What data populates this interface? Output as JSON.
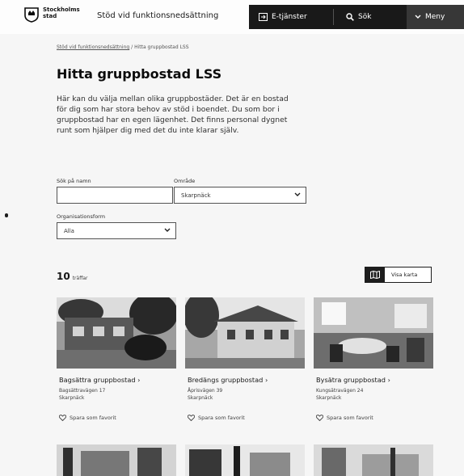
{
  "header": {
    "logo_text": "Stockholms stad",
    "site_title": "Stöd vid funktionsnedsättning",
    "nav": {
      "eservices": "E-tjänster",
      "search": "Sök",
      "menu": "Meny"
    }
  },
  "breadcrumb": {
    "parent": "Stöd vid funktionsnedsättning",
    "separator": "/",
    "current": "Hitta gruppbostad LSS"
  },
  "page": {
    "title": "Hitta gruppbostad LSS",
    "intro": "Här kan du välja mellan olika gruppbostäder. Det är en bostad för dig som har stora behov av stöd i boendet. Du som bor i gruppbostad har en egen lägenhet. Det finns personal dygnet runt som hjälper dig med det du inte klarar själv."
  },
  "filters": {
    "name_label": "Sök på namn",
    "name_value": "",
    "area_label": "Område",
    "area_value": "Skarpnäck",
    "org_label": "Organisationsform",
    "org_value": "Alla"
  },
  "results": {
    "count": "10",
    "unit": "träffar",
    "map_button": "Visa karta"
  },
  "cards": [
    {
      "name": "Bagsättra gruppbostad ›",
      "address": "Bagsättravägen 17",
      "area": "Skarpnäck",
      "fav": "Spara som favorit"
    },
    {
      "name": "Bredängs gruppbostad ›",
      "address": "Åprisvägen 39",
      "area": "Skarpnäck",
      "fav": "Spara som favorit"
    },
    {
      "name": "Bysätra gruppbostad ›",
      "address": "Kungsätravägen 24",
      "area": "Skarpnäck",
      "fav": "Spara som favorit"
    }
  ],
  "colors": {
    "nav_bg": "#1e1e1e",
    "page_bg": "#f0f0f0"
  }
}
